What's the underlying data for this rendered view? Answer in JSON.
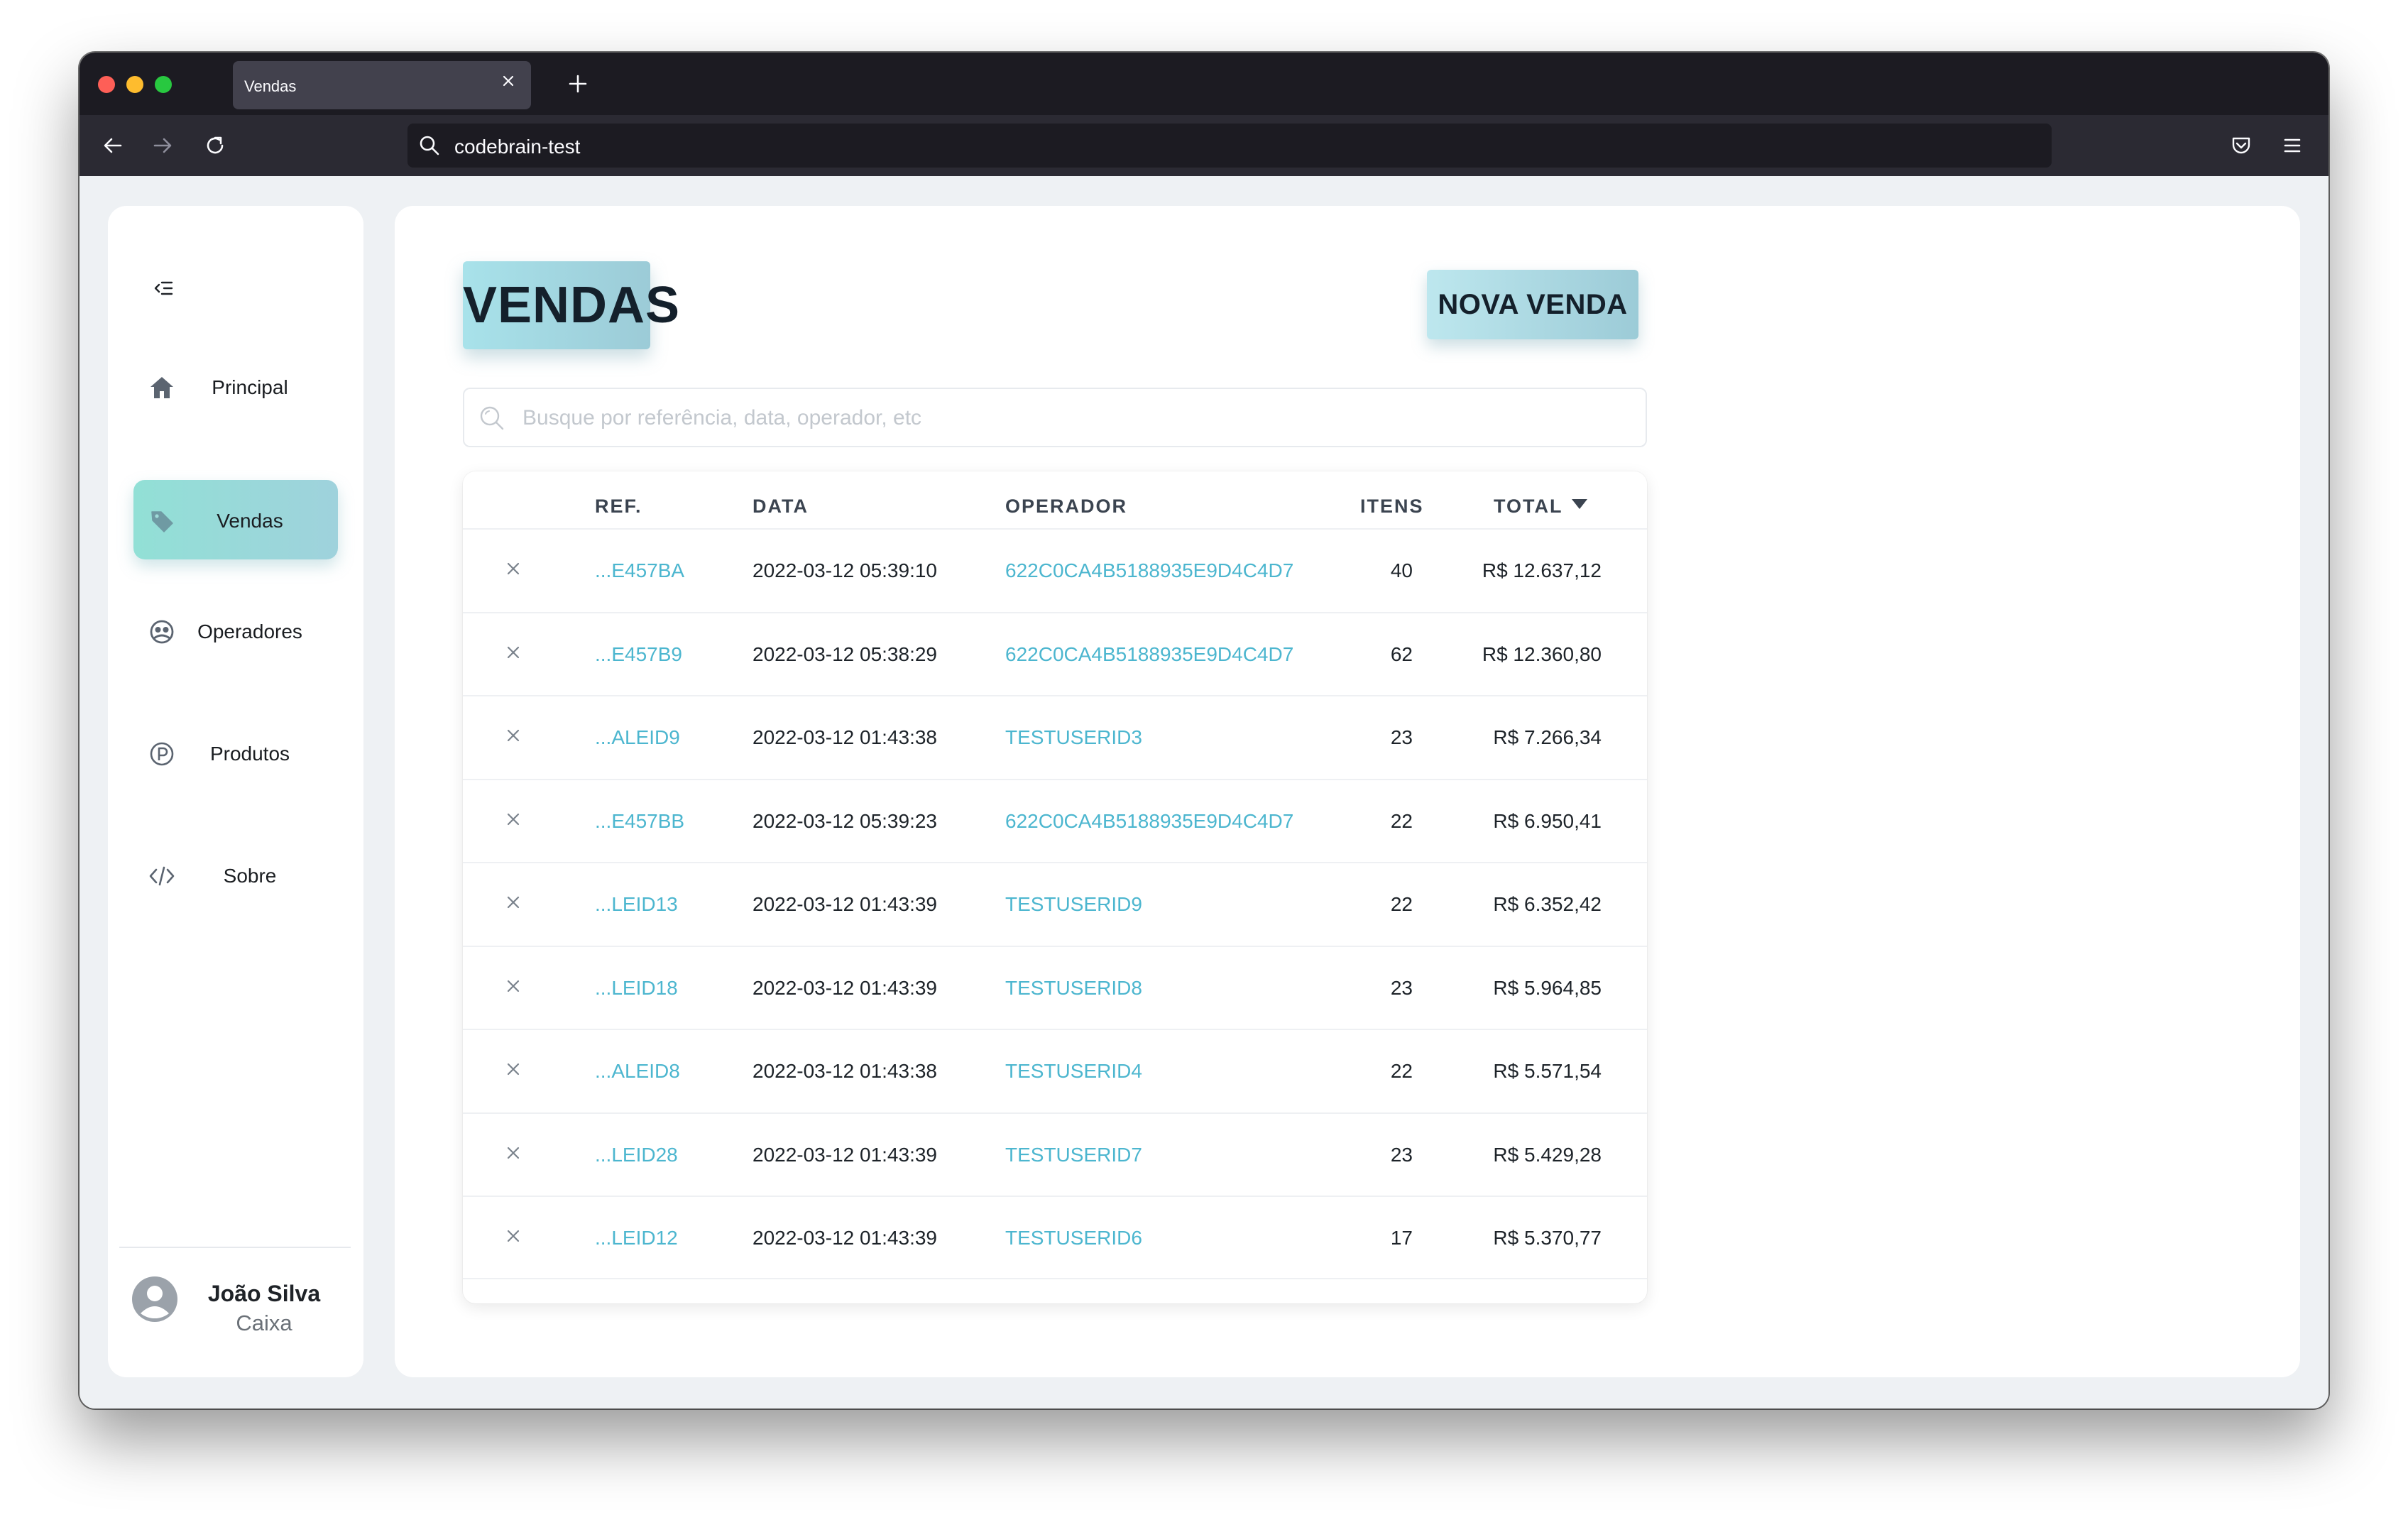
{
  "browser": {
    "tab_title": "Vendas",
    "url": "codebrain-test"
  },
  "sidebar": {
    "items": [
      {
        "label": "Principal",
        "icon": "home-icon"
      },
      {
        "label": "Vendas",
        "icon": "tag-icon",
        "active": true
      },
      {
        "label": "Operadores",
        "icon": "operators-icon"
      },
      {
        "label": "Produtos",
        "icon": "product-p-icon"
      },
      {
        "label": "Sobre",
        "icon": "code-icon"
      }
    ],
    "user": {
      "name": "João Silva",
      "role": "Caixa"
    }
  },
  "main": {
    "title": "VENDAS",
    "new_button": "NOVA VENDA",
    "search_placeholder": "Busque por referência, data, operador, etc",
    "table": {
      "headers": {
        "ref": "REF.",
        "data": "DATA",
        "operador": "OPERADOR",
        "itens": "ITENS",
        "total": "TOTAL"
      },
      "sort": {
        "column": "TOTAL",
        "direction": "desc"
      },
      "rows": [
        {
          "ref": "...E457BA",
          "data": "2022-03-12 05:39:10",
          "operador": "622C0CA4B5188935E9D4C4D7",
          "itens": "40",
          "total": "R$ 12.637,12"
        },
        {
          "ref": "...E457B9",
          "data": "2022-03-12 05:38:29",
          "operador": "622C0CA4B5188935E9D4C4D7",
          "itens": "62",
          "total": "R$ 12.360,80"
        },
        {
          "ref": "...ALEID9",
          "data": "2022-03-12 01:43:38",
          "operador": "TESTUSERID3",
          "itens": "23",
          "total": "R$ 7.266,34"
        },
        {
          "ref": "...E457BB",
          "data": "2022-03-12 05:39:23",
          "operador": "622C0CA4B5188935E9D4C4D7",
          "itens": "22",
          "total": "R$ 6.950,41"
        },
        {
          "ref": "...LEID13",
          "data": "2022-03-12 01:43:39",
          "operador": "TESTUSERID9",
          "itens": "22",
          "total": "R$ 6.352,42"
        },
        {
          "ref": "...LEID18",
          "data": "2022-03-12 01:43:39",
          "operador": "TESTUSERID8",
          "itens": "23",
          "total": "R$ 5.964,85"
        },
        {
          "ref": "...ALEID8",
          "data": "2022-03-12 01:43:38",
          "operador": "TESTUSERID4",
          "itens": "22",
          "total": "R$ 5.571,54"
        },
        {
          "ref": "...LEID28",
          "data": "2022-03-12 01:43:39",
          "operador": "TESTUSERID7",
          "itens": "23",
          "total": "R$ 5.429,28"
        },
        {
          "ref": "...LEID12",
          "data": "2022-03-12 01:43:39",
          "operador": "TESTUSERID6",
          "itens": "17",
          "total": "R$ 5.370,77"
        }
      ]
    }
  },
  "colors": {
    "accent": "#92e0d6",
    "link": "#4cb6cf",
    "title_bg": "#a8e2ea"
  }
}
